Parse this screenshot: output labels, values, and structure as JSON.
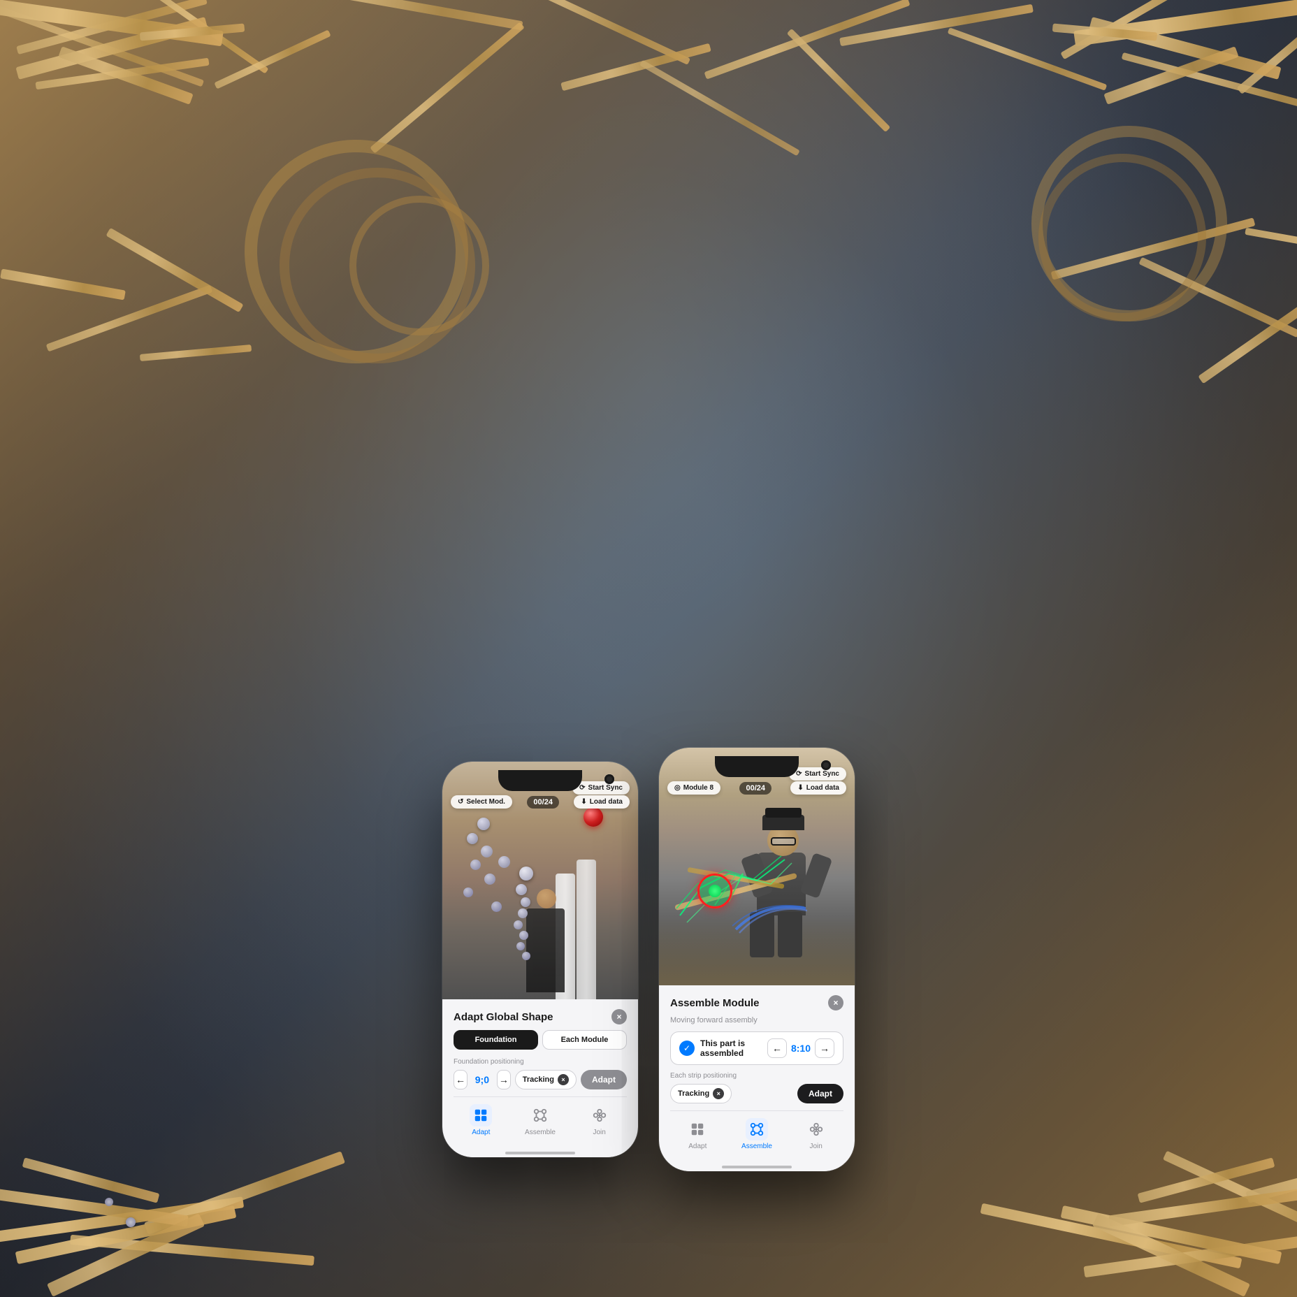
{
  "background": {
    "alt": "Wooden sculpture installation background"
  },
  "phones": {
    "phone1": {
      "counter": "00/24",
      "top_left_btn": "Select Mod.",
      "top_right_btn": "Load data",
      "sync_btn": "Start Sync",
      "select_icon": "↺",
      "load_icon": "⬇",
      "sync_icon": "⟳",
      "panel": {
        "title": "Adapt Global Shape",
        "close": "×",
        "tab1": "Foundation",
        "tab2": "Each Module",
        "positioning_label": "Foundation positioning",
        "nav_value": "9;0",
        "tracking_label": "Tracking",
        "adapt_label": "Adapt"
      },
      "nav": {
        "adapt_label": "Adapt",
        "assemble_label": "Assemble",
        "join_label": "Join"
      }
    },
    "phone2": {
      "counter": "00/24",
      "top_left_btn": "Module 8",
      "top_right_btn": "Load data",
      "sync_btn": "Start Sync",
      "select_icon": "◎",
      "load_icon": "⬇",
      "sync_icon": "⟳",
      "panel": {
        "title": "Assemble Module",
        "close": "×",
        "subtitle": "Moving forward assembly",
        "assembled_text": "This part is assembled",
        "nav_value": "8:10",
        "strip_label": "Each strip positioning",
        "tracking_label": "Tracking",
        "adapt_label": "Adapt"
      },
      "nav": {
        "adapt_label": "Adapt",
        "assemble_label": "Assemble",
        "join_label": "Join"
      }
    }
  },
  "colors": {
    "blue": "#007aff",
    "dark": "#1a1a1a",
    "gray": "#8e8e93",
    "light_bg": "#f5f5f7",
    "white": "#ffffff",
    "tab_active_bg": "#1a1a1a",
    "tab_active_text": "#ffffff",
    "adapt_btn": "#3c3c3e"
  }
}
